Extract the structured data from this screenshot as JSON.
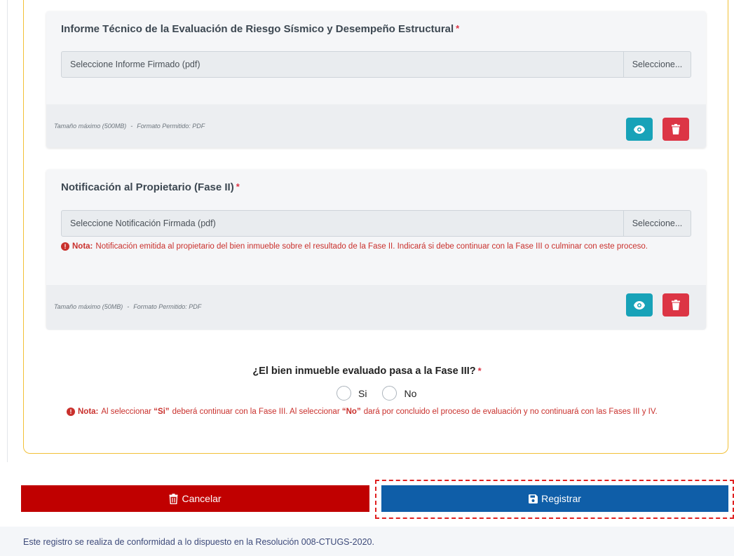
{
  "card1": {
    "title": "Informe Técnico de la Evaluación de Riesgo Sísmico y Desempeño Estructural",
    "required_mark": "*",
    "file_placeholder": "Seleccione Informe Firmado (pdf)",
    "browse_label": "Seleccione...",
    "max_size": "Tamaño máximo (500MB)",
    "separator": "-",
    "format": "Formato Permitido: PDF",
    "view_icon": "eye-icon",
    "delete_icon": "trash-icon"
  },
  "card2": {
    "title": "Notificación al Propietario (Fase II)",
    "required_mark": "*",
    "file_placeholder": "Seleccione Notificación Firmada (pdf)",
    "browse_label": "Seleccione...",
    "note_label": "Nota:",
    "note_text": "Notificación emitida al propietario del bien inmueble sobre el resultado de la Fase II. Indicará si debe continuar con la Fase III o culminar con este proceso.",
    "max_size": "Tamaño máximo (50MB)",
    "separator": "-",
    "format": "Formato Permitido: PDF",
    "view_icon": "eye-icon",
    "delete_icon": "trash-icon"
  },
  "question": {
    "text": "¿El bien inmueble evaluado pasa a la Fase III?",
    "required_mark": "*",
    "options": [
      "Si",
      "No"
    ],
    "note_label": "Nota:",
    "note_part1": "Al seleccionar",
    "note_si": "“Si”",
    "note_part2": "deberá continuar con la Fase III. Al seleccionar",
    "note_no": "“No”",
    "note_part3": "dará por concluido el proceso de evaluación y no continuará con las Fases III y IV."
  },
  "actions": {
    "cancel_label": "Cancelar",
    "register_label": "Registrar"
  },
  "footer": {
    "text": "Este registro se realiza de conformidad a lo dispuesto en la Resolución 008-CTUGS-2020."
  },
  "colors": {
    "panel_border": "#f2c037",
    "cancel": "#c00000",
    "register": "#0f5ea8",
    "view": "#17a2b8",
    "delete": "#dc3545",
    "note": "#c9302c",
    "highlight": "#e02020"
  }
}
